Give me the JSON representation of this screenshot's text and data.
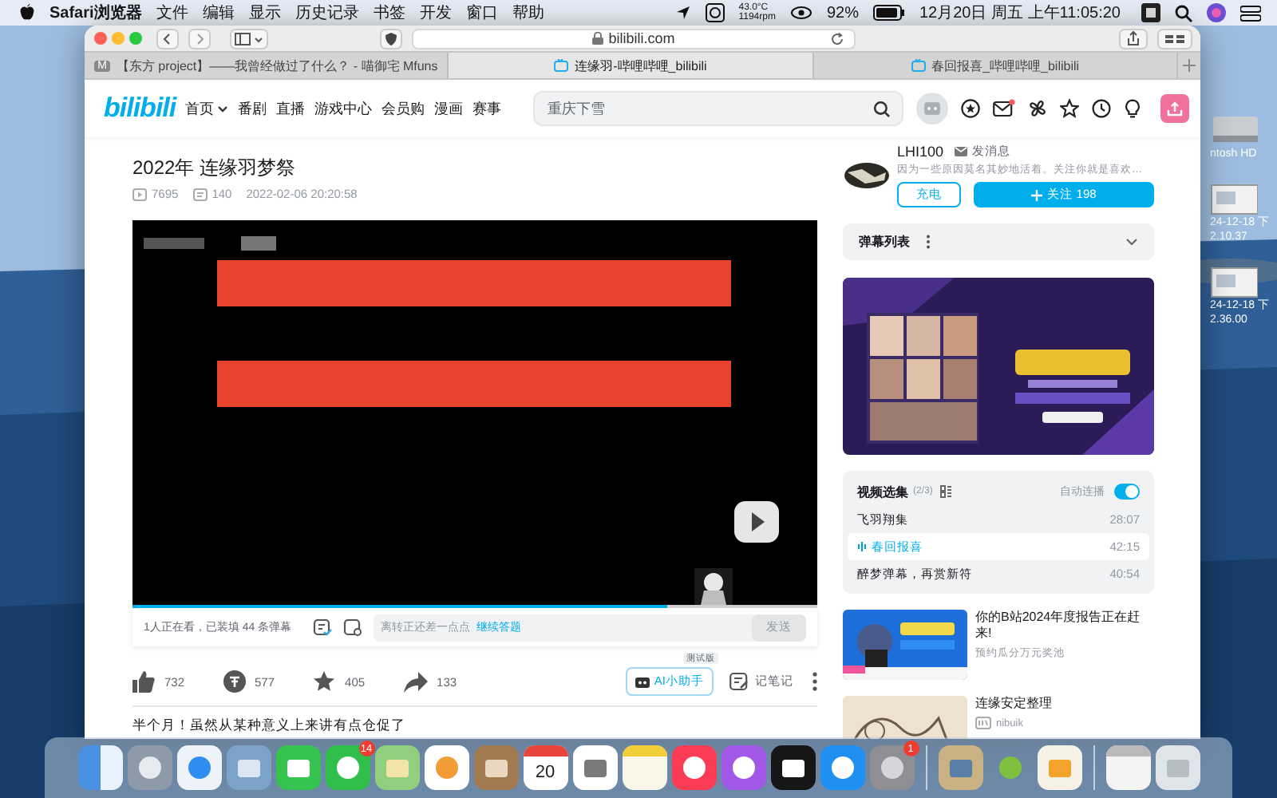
{
  "menubar": {
    "app": "Safari浏览器",
    "menus": [
      "文件",
      "编辑",
      "显示",
      "历史记录",
      "书签",
      "开发",
      "窗口",
      "帮助"
    ],
    "temperature": "43.0°C",
    "fan_speed": "1194rpm",
    "battery": "92%",
    "clock": "12月20日 周五 上午11:05:20"
  },
  "desktop": {
    "items": [
      {
        "kind": "disk",
        "lines": [
          "ntosh HD"
        ]
      },
      {
        "kind": "file",
        "lines": [
          "24-12-18 下",
          "2.10.37"
        ]
      },
      {
        "kind": "file",
        "lines": [
          "24-12-18 下",
          "2.36.00"
        ]
      }
    ]
  },
  "safari": {
    "url": "bilibili.com",
    "tabs": [
      {
        "title": "【东方 project】——我曾经做过了什么？ - 喵御宅 Mfuns",
        "favicon_letter": "M",
        "selected": false
      },
      {
        "title": "连缘羽-哔哩哔哩_bilibili",
        "selected": true
      },
      {
        "title": "春回报喜_哔哩哔哩_bilibili",
        "selected": false
      }
    ]
  },
  "site": {
    "logo": "bilibili",
    "nav": [
      {
        "label": "首页",
        "dropdown": true
      },
      {
        "label": "番剧",
        "dropdown": false
      },
      {
        "label": "直播",
        "dropdown": false
      },
      {
        "label": "游戏中心",
        "dropdown": false
      },
      {
        "label": "会员购",
        "dropdown": false
      },
      {
        "label": "漫画",
        "dropdown": false
      },
      {
        "label": "赛事",
        "dropdown": false
      }
    ],
    "search_placeholder": "重庆下雪",
    "message_dot": true
  },
  "video": {
    "title": "2022年 连缘羽梦祭",
    "views": "7695",
    "danmaku_count": "140",
    "date": "2022-02-06 20:20:58",
    "progress": {
      "level": 0.78
    },
    "viewers": "1人正在看，已装填 44 条弹幕",
    "danmaku_field": {
      "prompt": "离转正还差一点点",
      "link": "继续答题"
    },
    "send": "发送",
    "actions": [
      {
        "kind": "like",
        "count": "732"
      },
      {
        "kind": "coin",
        "count": "577"
      },
      {
        "kind": "favorite",
        "count": "405"
      },
      {
        "kind": "share",
        "count": "133"
      }
    ],
    "ai_assistant": {
      "label": "AI小助手",
      "badge": "测试版"
    },
    "notes": "记笔记"
  },
  "comment_preview": "半个月！虽然从某种意义上来讲有点仓促了",
  "uploader": {
    "name": "LHI100",
    "message": "发消息",
    "bio": "因为一些原因莫名其妙地活着。关注你就是喜欢…",
    "charge": "充电",
    "follow": "关注 198"
  },
  "danmaku_list": {
    "title": "弹幕列表"
  },
  "series": {
    "title": "视频选集",
    "count": "(2/3)",
    "autoplay": {
      "label": "自动连播",
      "on": true
    },
    "episodes": [
      {
        "title": "飞羽翔集",
        "duration": "28:07",
        "selected": false
      },
      {
        "title": "春回报喜",
        "duration": "42:15",
        "selected": true
      },
      {
        "title": "醉梦弹幕，再赏新符",
        "duration": "40:54",
        "selected": false
      }
    ]
  },
  "recommendations": [
    {
      "title": "你的B站2024年度报告正在赶来!",
      "subtitle": "预约瓜分万元奖池",
      "kind": "promo"
    },
    {
      "title": "连缘安定整理",
      "subtitle": "nibuik",
      "kind": "video"
    }
  ],
  "dock": {
    "apps": [
      {
        "kind": "finder"
      },
      {
        "kind": "launchpad"
      },
      {
        "kind": "safari"
      },
      {
        "kind": "preview"
      },
      {
        "kind": "facetime"
      },
      {
        "kind": "messages",
        "badge": "14"
      },
      {
        "kind": "maps"
      },
      {
        "kind": "photos"
      },
      {
        "kind": "contacts"
      },
      {
        "kind": "calendar",
        "day": "20"
      },
      {
        "kind": "reminders"
      },
      {
        "kind": "notes"
      },
      {
        "kind": "music"
      },
      {
        "kind": "podcasts"
      },
      {
        "kind": "tv"
      },
      {
        "kind": "appstore"
      },
      {
        "kind": "settings",
        "badge": "1"
      },
      {
        "kind": "divider"
      },
      {
        "kind": "pictures"
      },
      {
        "kind": "android"
      },
      {
        "kind": "pen"
      },
      {
        "kind": "divider"
      },
      {
        "kind": "document"
      },
      {
        "kind": "trash"
      }
    ]
  }
}
